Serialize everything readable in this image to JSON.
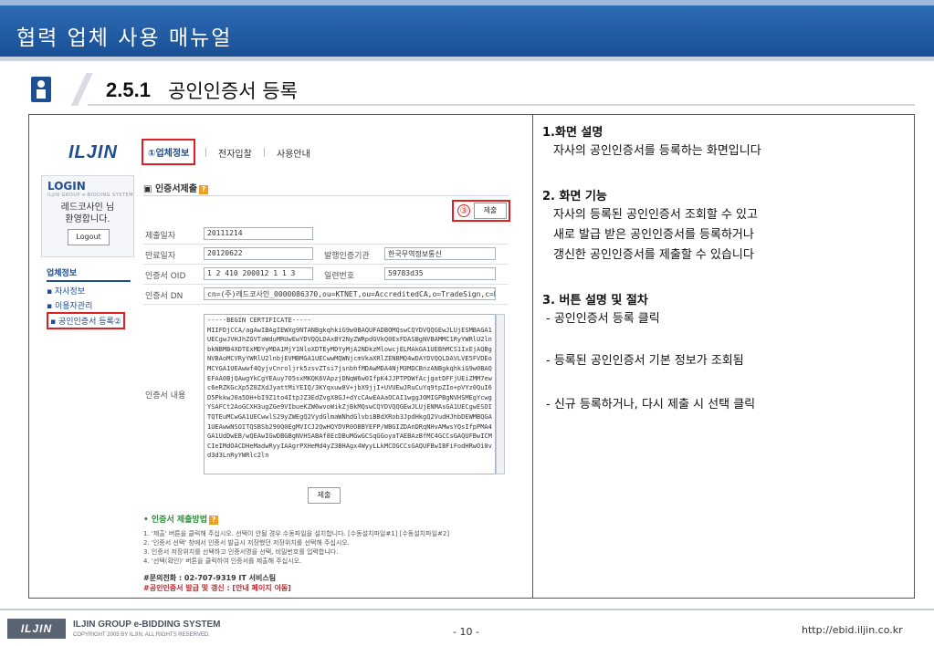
{
  "header": {
    "title": "협력 업체 사용 매뉴얼"
  },
  "section": {
    "number": "2.5.1",
    "title": "공인인증서 등록"
  },
  "screenshot": {
    "logo": "ILJIN",
    "nav": {
      "active": "①업체정보",
      "item2": "전자입찰",
      "item3": "사용안내"
    },
    "login": {
      "title": "LOGIN",
      "subtitle": "ILJIN GROUP e-BIDDING SYSTEM",
      "user": "레드코사인 님\n환영합니다.",
      "logout": "Logout"
    },
    "menu": {
      "head": "업체정보",
      "item1": "▪ 자사정보",
      "item2": "▪ 이용자관리",
      "item3": "▪ 공인인증서 등록②"
    },
    "pane": {
      "title": "인증서제출",
      "submit_top": "제출",
      "badge": "③",
      "rows": [
        {
          "label": "제출일자",
          "value": "20111214"
        },
        {
          "label": "만료일자",
          "value": "20120622",
          "label2": "발행인증기관",
          "value2": "한국무역정보통신"
        },
        {
          "label": "인증서 OID",
          "value": "1 2 410 200012 1 1 3",
          "label2": "일련번호",
          "value2": "59783d35"
        },
        {
          "label": "인증서 DN",
          "value": "cn=(주)레드코사인_0000086370,ou=KTNET,ou=AccreditedCA,o=TradeSign,c=KR"
        }
      ],
      "cert_label": "인증서 내용",
      "cert_text": "-----BEGIN CERTIFICATE-----\nMIIFDjCCA/agAwIBAgIEWXg9NTANBgkqhkiG9w0BAQUFADBOMQswCQYDVQQGEwJLUjESMBAGA1UECgwJVHJhZGVTaWduMRUwEwYDVQQLDAxBY2NyZWRpdGVkQ0ExFDASBgNVBAMMC1RyYWRlU2lnbkNBMB4XDTExMDYyMDA1MjY1NloXDTEyMDYyMjA2NDkzMlowcjELMAkGA1UEBhMCS1IxEjAQBgNVBAoMCVRyYWRlU2lnbjEVMBMGA1UECwwMQWNjcmVkaXRlZENBMQ4wDAYDVQQLDAVLVE5FVDEoMCYGA1UEAwwf4QyjvCnroljrk5zsvZTsi7jsnbhfMDAwMDA4NjM3MDCBnzANBgkqhkiG9w0BAQEFAA0BjQAwgYkCgYEAuy7O5sxMKQK6VApzjDNqW6w0IfpK4JJPTPDWfAcjgatDFFjUEiZMM7ewc6eRZKGcXp5Z0ZXdJyattMiYEIQ/3KYqxuw8V+jbX9jjI+UVUEwJRuCuYq9tpZIo+pVYz0QuI6D5PkkwJ0a5DH+bI9Z1to4ItpJZ3EdZvgX8GJ+dYcCAwEAAaOCAI1wggJOMIGPBgNVHSMEgYcwgYSAFCt2AoGCXH3ugZGe9VIbueKZW6wvoWikZjBkMQswCQYDVQQGEwJLUjENMAsGA1UECgwESOITQTEuMCwGA1UECwwlS29yZWEgQ2VydGlmaWNhdGlvbiBBdXRob3JpdHkgQ2VudHJhbDEWMBQGA1UEAwwNSOITQSBSb290Q0EgMVICJ2QwHQYDVR0OBBYEFP/WBGIZDAnDRqNHvAMwsYQsIfpPMA4GA1UdDwEB/wQEAwIGwDBGBgNVHSABAf8EcDBuMGwGCSqGGoyaTAEBAzBfMC4GCCsGAQUFBwICMCIeIMdOACDHeMadwRyyIAAgrPXHeMd4yZ3BHAgx4WyyLLkMCOGCCsGAQUFBwIBFiFodHRwOi8vd3d3LnRyYWRlc2ln",
      "submit_bot": "제출",
      "howto_title": "• 인증서 제출방법",
      "howto": [
        "1. '제출' 버튼을 클릭해 주십시오. 선택이 안될 경우 수동파일을 설치합니다. [수동설치파일#1] [수동설치파일#2]",
        "2. '인증서 선택' 창에서 인증서 발급시 저장했던 저장위치를 선택해 주십시오.",
        "3. 인증서 저장위치를 선택하고 인증서명을 선택, 비밀번호를 입력합니다.",
        "4. '선택(확인)' 버튼을 클릭하여 인증서를 제출해 주십시오."
      ],
      "contact1": "#문의전화 : 02-707-9319 IT 서비스팀",
      "contact2": "#공인인증서 발급 및 갱신 : [안내 페이지 이동]"
    }
  },
  "description": {
    "h1": "1.화면 설명",
    "t1": "자사의 공인인증서를 등록하는 화면입니다",
    "h2": "2. 화면 기능",
    "t2a": "자사의 등록된 공인인증서 조회할 수 있고",
    "t2b": "새로 발급 받은 공인인증서를 등록하거나",
    "t2c": "갱신한 공인인증서를 제출할 수 있습니다",
    "h3": "3. 버튼 설명 및 절차",
    "s1": "- 공인인증서 등록 클릭",
    "s2": "- 등록된 공인인증서 기본 정보가 조회됨",
    "s3": "- 신규 등록하거나, 다시 제출 시 선택 클릭"
  },
  "footer": {
    "logo": "ILJIN",
    "name": "ILJIN GROUP e-BIDDING SYSTEM",
    "copyright": "COPYRIGHT 2005 BY ILJIN. ALL RIGHTS RESERVED.",
    "page": "- 10 -",
    "url": "http://ebid.iljin.co.kr"
  }
}
